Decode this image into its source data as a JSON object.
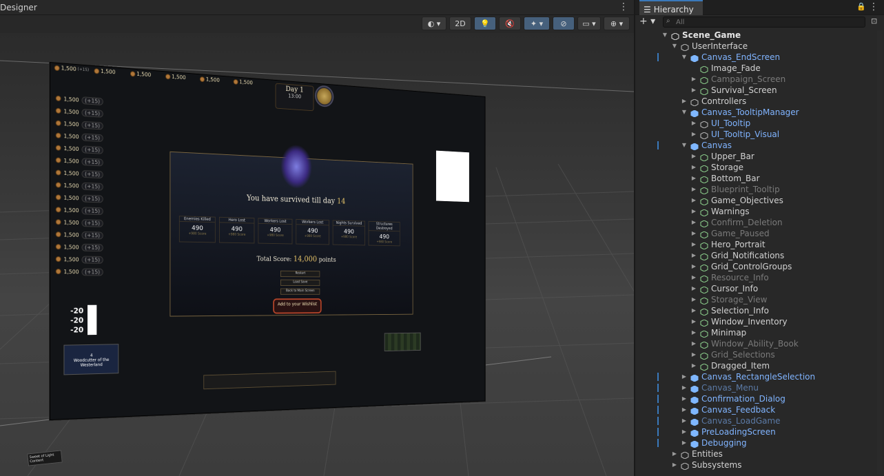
{
  "scene_panel": {
    "title": "Designer",
    "toolbar": {
      "mode_2d": "2D"
    }
  },
  "game": {
    "resources": {
      "amount": "1,500",
      "rate": "(+15)",
      "stock": "100"
    },
    "day": {
      "label": "Day",
      "number": "1",
      "time": "13:00"
    },
    "end_screen": {
      "survived_text": "You have survived till day",
      "survived_day": "14",
      "stats": [
        {
          "header": "Enemies Killed",
          "value": "490",
          "score": "+980 Score"
        },
        {
          "header": "Hero Lost",
          "value": "490",
          "score": "+980 Score"
        },
        {
          "header": "Workers Lost",
          "value": "490",
          "score": "+980 Score"
        },
        {
          "header": "Workers Lost",
          "value": "490",
          "score": "+980 Score"
        },
        {
          "header": "Nights Survived",
          "value": "490",
          "score": "+980 Score"
        },
        {
          "header": "Structures Destroyed",
          "value": "490",
          "score": "+980 Score"
        }
      ],
      "total_label": "Total Score:",
      "total_value": "14,000",
      "total_unit": "points",
      "buttons": [
        "Restart",
        "Load Save",
        "Back to Main Screen"
      ],
      "wishlist": "Add to your Wishlist"
    },
    "side_numbers": [
      "-20",
      "-20",
      "-20"
    ],
    "portrait": {
      "name": "Woodcutter of the Westerland",
      "level": "4"
    },
    "sweet_tag": "Sweet of Light Content"
  },
  "hierarchy": {
    "title": "Hierarchy",
    "search_placeholder": "All",
    "rows": [
      {
        "label": "Scene_Game",
        "depth": 0,
        "arrow": "▼",
        "icon": "unity-scene",
        "style": "scene",
        "chev": false,
        "mark": false
      },
      {
        "label": "UserInterface",
        "depth": 1,
        "arrow": "▼",
        "icon": "gameobject",
        "style": "normal",
        "chev": false,
        "mark": false
      },
      {
        "label": "Canvas_EndScreen",
        "depth": 2,
        "arrow": "▼",
        "icon": "prefab",
        "style": "prefab",
        "chev": true,
        "mark": true
      },
      {
        "label": "Image_Fade",
        "depth": 3,
        "arrow": "",
        "icon": "gameobject-green",
        "style": "normal",
        "chev": false,
        "mark": false
      },
      {
        "label": "Campaign_Screen",
        "depth": 3,
        "arrow": "▶",
        "icon": "gameobject-green",
        "style": "dim",
        "chev": false,
        "mark": false
      },
      {
        "label": "Survival_Screen",
        "depth": 3,
        "arrow": "▶",
        "icon": "gameobject-green",
        "style": "normal",
        "chev": false,
        "mark": false
      },
      {
        "label": "Controllers",
        "depth": 2,
        "arrow": "▶",
        "icon": "gameobject",
        "style": "normal",
        "chev": false,
        "mark": false
      },
      {
        "label": "Canvas_TooltipManager",
        "depth": 2,
        "arrow": "▼",
        "icon": "prefab",
        "style": "prefab",
        "chev": true,
        "mark": false
      },
      {
        "label": "UI_Tooltip",
        "depth": 3,
        "arrow": "▶",
        "icon": "gameobject",
        "style": "prefab",
        "chev": false,
        "mark": false
      },
      {
        "label": "UI_Tooltip_Visual",
        "depth": 3,
        "arrow": "▶",
        "icon": "gameobject",
        "style": "prefab",
        "chev": false,
        "mark": false
      },
      {
        "label": "Canvas",
        "depth": 2,
        "arrow": "▼",
        "icon": "prefab",
        "style": "prefab",
        "chev": true,
        "mark": true
      },
      {
        "label": "Upper_Bar",
        "depth": 3,
        "arrow": "▶",
        "icon": "gameobject-green",
        "style": "normal",
        "chev": false,
        "mark": false
      },
      {
        "label": "Storage",
        "depth": 3,
        "arrow": "▶",
        "icon": "gameobject-green",
        "style": "normal",
        "chev": false,
        "mark": false
      },
      {
        "label": "Bottom_Bar",
        "depth": 3,
        "arrow": "▶",
        "icon": "gameobject-green",
        "style": "normal",
        "chev": false,
        "mark": false
      },
      {
        "label": "Blueprint_Tooltip",
        "depth": 3,
        "arrow": "▶",
        "icon": "gameobject-green",
        "style": "dim",
        "chev": false,
        "mark": false
      },
      {
        "label": "Game_Objectives",
        "depth": 3,
        "arrow": "▶",
        "icon": "gameobject-green",
        "style": "normal",
        "chev": false,
        "mark": false
      },
      {
        "label": "Warnings",
        "depth": 3,
        "arrow": "▶",
        "icon": "gameobject-green",
        "style": "normal",
        "chev": false,
        "mark": false
      },
      {
        "label": "Confirm_Deletion",
        "depth": 3,
        "arrow": "▶",
        "icon": "gameobject-green",
        "style": "dim",
        "chev": false,
        "mark": false
      },
      {
        "label": "Game_Paused",
        "depth": 3,
        "arrow": "▶",
        "icon": "gameobject-green",
        "style": "dim",
        "chev": false,
        "mark": false
      },
      {
        "label": "Hero_Portrait",
        "depth": 3,
        "arrow": "▶",
        "icon": "gameobject-green",
        "style": "normal",
        "chev": false,
        "mark": false
      },
      {
        "label": "Grid_Notifications",
        "depth": 3,
        "arrow": "▶",
        "icon": "gameobject-green",
        "style": "normal",
        "chev": false,
        "mark": false
      },
      {
        "label": "Grid_ControlGroups",
        "depth": 3,
        "arrow": "▶",
        "icon": "gameobject-green",
        "style": "normal",
        "chev": false,
        "mark": false
      },
      {
        "label": "Resource_Info",
        "depth": 3,
        "arrow": "▶",
        "icon": "gameobject-green",
        "style": "dim",
        "chev": false,
        "mark": false
      },
      {
        "label": "Cursor_Info",
        "depth": 3,
        "arrow": "▶",
        "icon": "gameobject-green",
        "style": "normal",
        "chev": false,
        "mark": false
      },
      {
        "label": "Storage_View",
        "depth": 3,
        "arrow": "▶",
        "icon": "gameobject-green",
        "style": "dim",
        "chev": false,
        "mark": false
      },
      {
        "label": "Selection_Info",
        "depth": 3,
        "arrow": "▶",
        "icon": "gameobject-green",
        "style": "normal",
        "chev": false,
        "mark": false
      },
      {
        "label": "Window_Inventory",
        "depth": 3,
        "arrow": "▶",
        "icon": "gameobject-green",
        "style": "normal",
        "chev": false,
        "mark": false
      },
      {
        "label": "Minimap",
        "depth": 3,
        "arrow": "▶",
        "icon": "gameobject-green",
        "style": "normal",
        "chev": false,
        "mark": false
      },
      {
        "label": "Window_Ability_Book",
        "depth": 3,
        "arrow": "▶",
        "icon": "gameobject-green",
        "style": "dim",
        "chev": false,
        "mark": false
      },
      {
        "label": "Grid_Selections",
        "depth": 3,
        "arrow": "▶",
        "icon": "gameobject-green",
        "style": "dim",
        "chev": false,
        "mark": false
      },
      {
        "label": "Dragged_Item",
        "depth": 3,
        "arrow": "▶",
        "icon": "gameobject-green",
        "style": "normal",
        "chev": false,
        "mark": false
      },
      {
        "label": "Canvas_RectangleSelection",
        "depth": 2,
        "arrow": "▶",
        "icon": "prefab",
        "style": "prefab",
        "chev": true,
        "mark": true
      },
      {
        "label": "Canvas_Menu",
        "depth": 2,
        "arrow": "▶",
        "icon": "prefab",
        "style": "dimprefab",
        "chev": true,
        "mark": true
      },
      {
        "label": "Confirmation_Dialog",
        "depth": 2,
        "arrow": "▶",
        "icon": "prefab",
        "style": "prefab",
        "chev": true,
        "mark": true
      },
      {
        "label": "Canvas_Feedback",
        "depth": 2,
        "arrow": "▶",
        "icon": "prefab",
        "style": "prefab",
        "chev": true,
        "mark": true
      },
      {
        "label": "Canvas_LoadGame",
        "depth": 2,
        "arrow": "▶",
        "icon": "prefab",
        "style": "dimprefab",
        "chev": true,
        "mark": true
      },
      {
        "label": "PreLoadingScreen",
        "depth": 2,
        "arrow": "▶",
        "icon": "prefab",
        "style": "prefab",
        "chev": true,
        "mark": true
      },
      {
        "label": "Debugging",
        "depth": 2,
        "arrow": "▶",
        "icon": "prefab",
        "style": "prefab",
        "chev": true,
        "mark": true
      },
      {
        "label": "Entities",
        "depth": 1,
        "arrow": "▶",
        "icon": "gameobject",
        "style": "normal",
        "chev": false,
        "mark": false
      },
      {
        "label": "Subsystems",
        "depth": 1,
        "arrow": "▶",
        "icon": "gameobject",
        "style": "normal",
        "chev": false,
        "mark": false
      }
    ]
  },
  "colors": {
    "accent": "#3a79bb",
    "prefab_text": "#80b4ff",
    "score_gold": "#e4c167"
  }
}
